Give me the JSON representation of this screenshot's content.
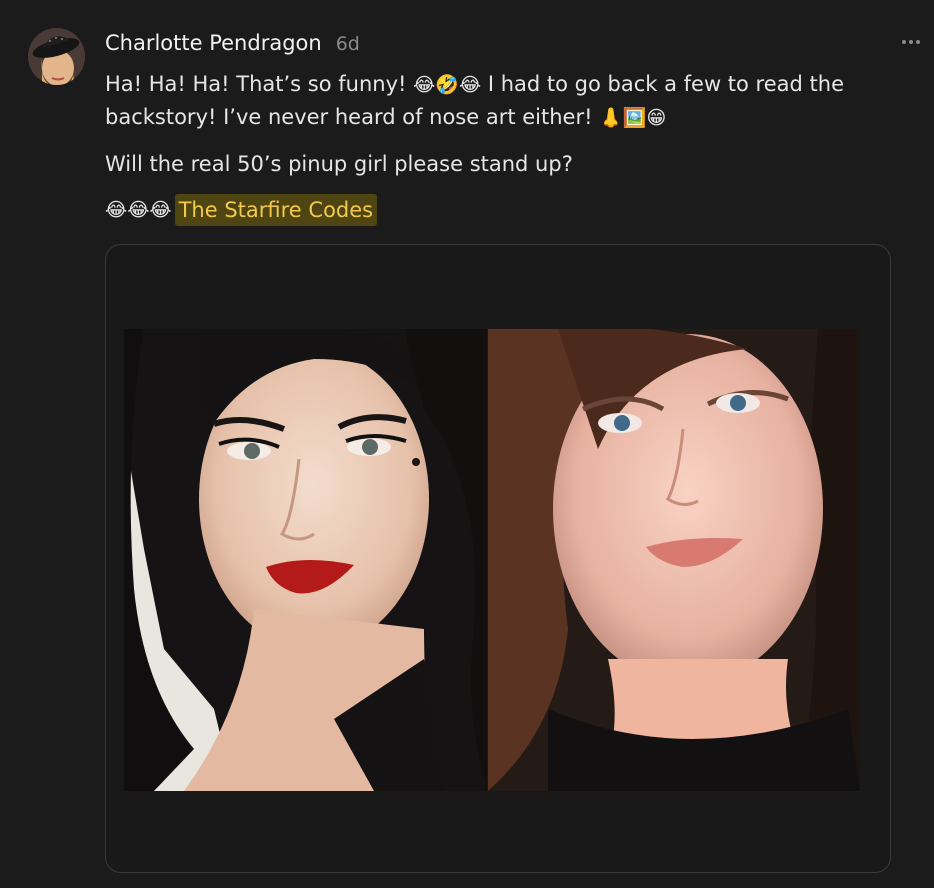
{
  "post": {
    "author": "Charlotte Pendragon",
    "time": "6d",
    "line1_text": "Ha! Ha! Ha! That’s so funny! ",
    "line1_emoji": "😂🤣😂",
    "line1_rest": " I had to go back a few to read the backstory! I’ve never heard of nose art either! ",
    "line1_end_emoji": "👃🖼️😁",
    "paragraph2": "Will the real 50’s pinup girl please stand up?",
    "p3_emoji": "😂😂😂",
    "tag": "The Starfire Codes"
  },
  "icons": {
    "avatar": "profile-photo",
    "more": "ellipsis-icon"
  },
  "colors": {
    "background": "#1b1b1c",
    "tag_background": "#4f4512",
    "tag_text": "#f2c94c",
    "card_border": "#3a3a3c"
  }
}
